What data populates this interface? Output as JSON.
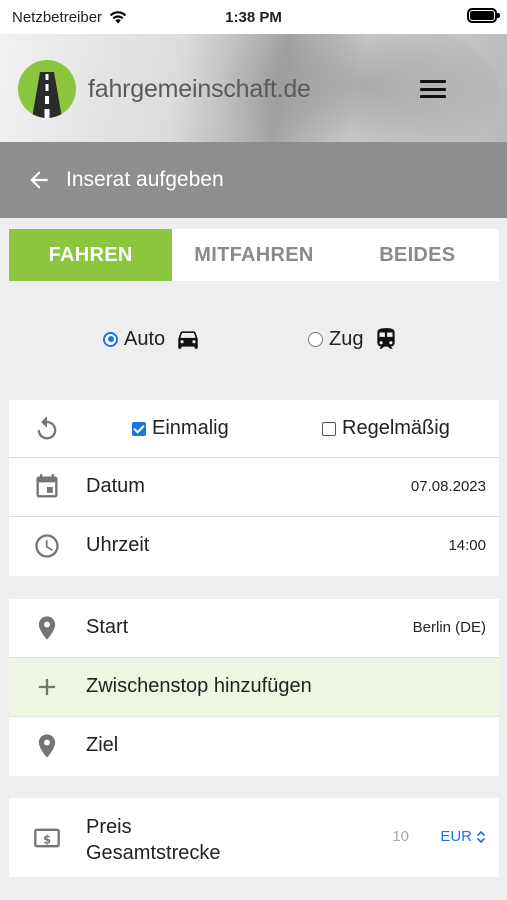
{
  "status_bar": {
    "carrier": "Netzbetreiber",
    "time": "1:38 PM"
  },
  "header": {
    "brand": "fahrgemeinschaft.de"
  },
  "title_bar": {
    "title": "Inserat aufgeben"
  },
  "tabs": [
    {
      "label": "FAHREN",
      "active": true
    },
    {
      "label": "MITFAHREN",
      "active": false
    },
    {
      "label": "BEIDES",
      "active": false
    }
  ],
  "transport": {
    "options": [
      {
        "label": "Auto",
        "selected": true,
        "icon": "car-icon"
      },
      {
        "label": "Zug",
        "selected": false,
        "icon": "train-icon"
      }
    ]
  },
  "schedule": {
    "frequency": [
      {
        "label": "Einmalig",
        "checked": true
      },
      {
        "label": "Regelmäßig",
        "checked": false
      }
    ],
    "date": {
      "label": "Datum",
      "value": "07.08.2023"
    },
    "time": {
      "label": "Uhrzeit",
      "value": "14:00"
    }
  },
  "route": {
    "start": {
      "label": "Start",
      "value": "Berlin (DE)"
    },
    "stopover": {
      "label": "Zwischenstop hinzufügen"
    },
    "destination": {
      "label": "Ziel",
      "value": ""
    }
  },
  "price": {
    "label_line1": "Preis",
    "label_line2": "Gesamtstrecke",
    "amount_placeholder": "10",
    "currency": "EUR"
  },
  "colors": {
    "accent_green": "#8cc63f",
    "title_bar_gray": "#8e8e8e",
    "link_blue": "#1a73e8",
    "stop_row_bg": "#eff5e3"
  }
}
